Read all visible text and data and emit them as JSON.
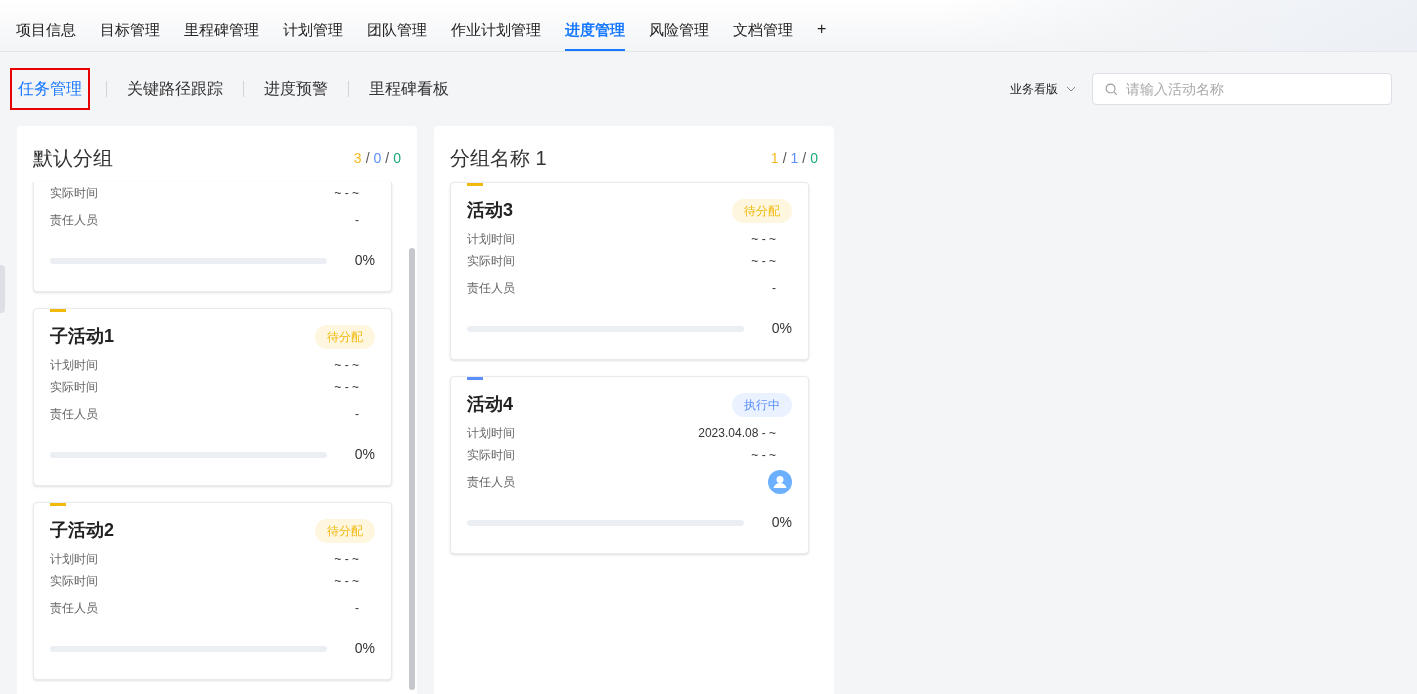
{
  "tabs": [
    {
      "label": "项目信息",
      "selected": false
    },
    {
      "label": "目标管理",
      "selected": false
    },
    {
      "label": "里程碑管理",
      "selected": false
    },
    {
      "label": "计划管理",
      "selected": false
    },
    {
      "label": "团队管理",
      "selected": false
    },
    {
      "label": "作业计划管理",
      "selected": false
    },
    {
      "label": "进度管理",
      "selected": true
    },
    {
      "label": "风险管理",
      "selected": false
    },
    {
      "label": "文档管理",
      "selected": false
    }
  ],
  "add_tab": "+",
  "subtabs": [
    {
      "label": "任务管理",
      "selected": true
    },
    {
      "label": "关键路径跟踪",
      "selected": false
    },
    {
      "label": "进度预警",
      "selected": false
    },
    {
      "label": "里程碑看板",
      "selected": false
    }
  ],
  "view_select": {
    "value": "业务看版"
  },
  "search": {
    "placeholder": "请输入活动名称"
  },
  "groups": [
    {
      "title": "默认分组",
      "separator": "/",
      "counts": [
        {
          "value": "3",
          "color": "#f5b91d"
        },
        {
          "value": "0",
          "color": "#5b8ff9"
        },
        {
          "value": "0",
          "color": "#19a97b"
        }
      ],
      "scrollbar": true,
      "cards": [
        {
          "cut_top": true,
          "rows": [
            {
              "label": "实际时间",
              "value": "~ - ~",
              "kind": "text"
            },
            {
              "label": "责任人员",
              "value": "-",
              "kind": "text"
            }
          ],
          "progress": {
            "reading": "0%"
          }
        },
        {
          "cut_top": false,
          "title": "子活动1",
          "status": {
            "kind": "pending",
            "label": "待分配"
          },
          "rows": [
            {
              "label": "计划时间",
              "value": "~ - ~",
              "kind": "text"
            },
            {
              "label": "实际时间",
              "value": "~ - ~",
              "kind": "text"
            },
            {
              "label": "责任人员",
              "value": "-",
              "kind": "text"
            }
          ],
          "progress": {
            "reading": "0%"
          }
        },
        {
          "cut_top": false,
          "title": "子活动2",
          "status": {
            "kind": "pending",
            "label": "待分配"
          },
          "rows": [
            {
              "label": "计划时间",
              "value": "~ - ~",
              "kind": "text"
            },
            {
              "label": "实际时间",
              "value": "~ - ~",
              "kind": "text"
            },
            {
              "label": "责任人员",
              "value": "-",
              "kind": "text"
            }
          ],
          "progress": {
            "reading": "0%"
          }
        }
      ]
    },
    {
      "title": "分组名称 1",
      "separator": "/",
      "counts": [
        {
          "value": "1",
          "color": "#f5b91d"
        },
        {
          "value": "1",
          "color": "#5b8ff9"
        },
        {
          "value": "0",
          "color": "#19a97b"
        }
      ],
      "scrollbar": false,
      "cards": [
        {
          "cut_top": false,
          "title": "活动3",
          "status": {
            "kind": "pending",
            "label": "待分配"
          },
          "rows": [
            {
              "label": "计划时间",
              "value": "~ - ~",
              "kind": "text"
            },
            {
              "label": "实际时间",
              "value": "~ - ~",
              "kind": "text"
            },
            {
              "label": "责任人员",
              "value": "-",
              "kind": "text"
            }
          ],
          "progress": {
            "reading": "0%"
          }
        },
        {
          "cut_top": false,
          "title": "活动4",
          "status": {
            "kind": "active",
            "label": "执行中"
          },
          "rows": [
            {
              "label": "计划时间",
              "value": "2023.04.08 - ~",
              "kind": "text"
            },
            {
              "label": "实际时间",
              "value": "~ - ~",
              "kind": "text"
            },
            {
              "label": "责任人员",
              "kind": "avatar"
            }
          ],
          "progress": {
            "reading": "0%"
          }
        }
      ]
    }
  ]
}
